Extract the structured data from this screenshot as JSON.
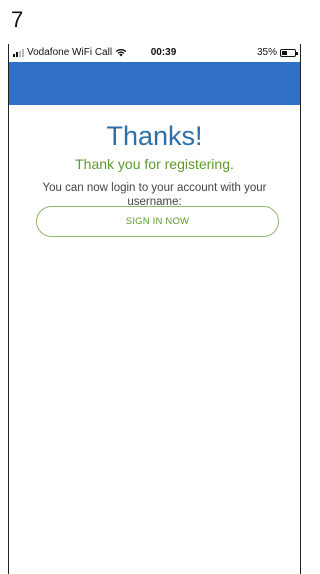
{
  "step_number": "7",
  "status_bar": {
    "carrier": "Vodafone WiFi Call",
    "time": "00:39",
    "battery_percent": "35%",
    "signal_icon": "signal-bars-icon",
    "wifi_icon": "wifi-icon",
    "battery_icon": "battery-icon",
    "battery_level": 0.35
  },
  "nav_bar": {
    "color": "#2f6fc6"
  },
  "main": {
    "title": "Thanks!",
    "subtitle": "Thank you for registering.",
    "message": "You can now login to your account with your username:",
    "sign_in_label": "SIGN IN NOW"
  },
  "colors": {
    "title": "#2f6fa8",
    "accent_green": "#5c9a2e",
    "button_border": "#8fb86d"
  }
}
